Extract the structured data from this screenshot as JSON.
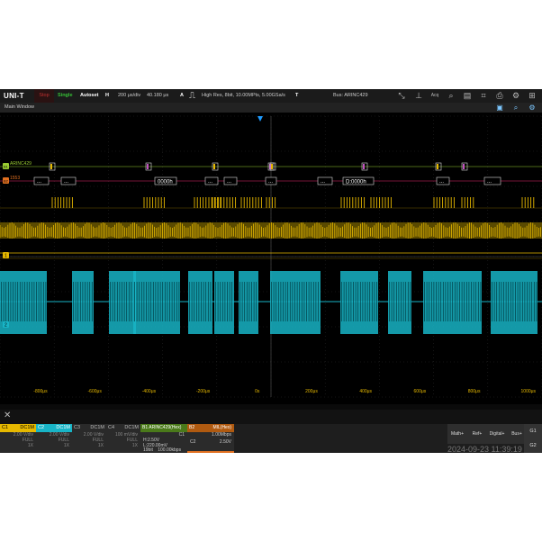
{
  "toolbar": {
    "logo": "UNI-T",
    "run_stop": "Stop",
    "single": "Single",
    "autoset": "Autoset",
    "horizontal_key": "H",
    "time_div": "200 μs/div",
    "time_pos": "40.180 μs",
    "acquire_key": "A",
    "acquire_info": "High Res, 8bit, 10.00MPts, 5.00GSa/s",
    "trigger_key": "T",
    "trigger_info": "Bus: ARINC429"
  },
  "main_window": {
    "title": "Main Window"
  },
  "waveform": {
    "bus1_label": "ARINC429",
    "bus2_label": "1553",
    "decode_1": "0000h",
    "decode_2": "D:0000h",
    "ellipsis": "...",
    "ch1_marker": "1",
    "ch2_marker": "2",
    "b1_marker": "B1",
    "b2_marker": "B2",
    "time_ticks": [
      "-800μs",
      "-600μs",
      "-400μs",
      "-200μs",
      "0s",
      "200μs",
      "400μs",
      "600μs",
      "800μs",
      "1000μs"
    ],
    "colors": {
      "ch1": "#e6b800",
      "ch2": "#18b4c6",
      "bus1": "#9acd32",
      "bus2": "#e07020",
      "math": "#c050c0"
    }
  },
  "channels": [
    {
      "name": "C1",
      "coupling": "DC1M",
      "scale": "2.00 V/div",
      "bw": "FULL",
      "probe": "1X",
      "color": "#e6b800"
    },
    {
      "name": "C2",
      "coupling": "DC1M",
      "scale": "2.00 V/div",
      "bw": "FULL",
      "probe": "1X",
      "color": "#18b4c6"
    },
    {
      "name": "C3",
      "coupling": "DC1M",
      "scale": "2.00 V/div",
      "bw": "FULL",
      "probe": "1X",
      "color": "#555555"
    },
    {
      "name": "C4",
      "coupling": "DC1M",
      "scale": "100 mV/div",
      "bw": "FULL",
      "probe": "1X",
      "color": "#555555"
    }
  ],
  "bus_b1": {
    "name": "B1",
    "protocol": "ARINC429(Hex)",
    "source": "C1",
    "high": "H:2.50V",
    "low": "L:220.00mV",
    "format": "19bit",
    "rate": "100.00kbps"
  },
  "bus_b2": {
    "name": "B2",
    "protocol": "MIL(Hex)",
    "rate": "1.00Mbps",
    "source": "C2",
    "level": "2.50V"
  },
  "buttons": {
    "math": "Math+",
    "ref": "Ref+",
    "digital": "Digital+",
    "bus": "Bus+",
    "g1": "G1",
    "g2": "G2"
  },
  "datetime": "2024-09-23 11:39:19"
}
